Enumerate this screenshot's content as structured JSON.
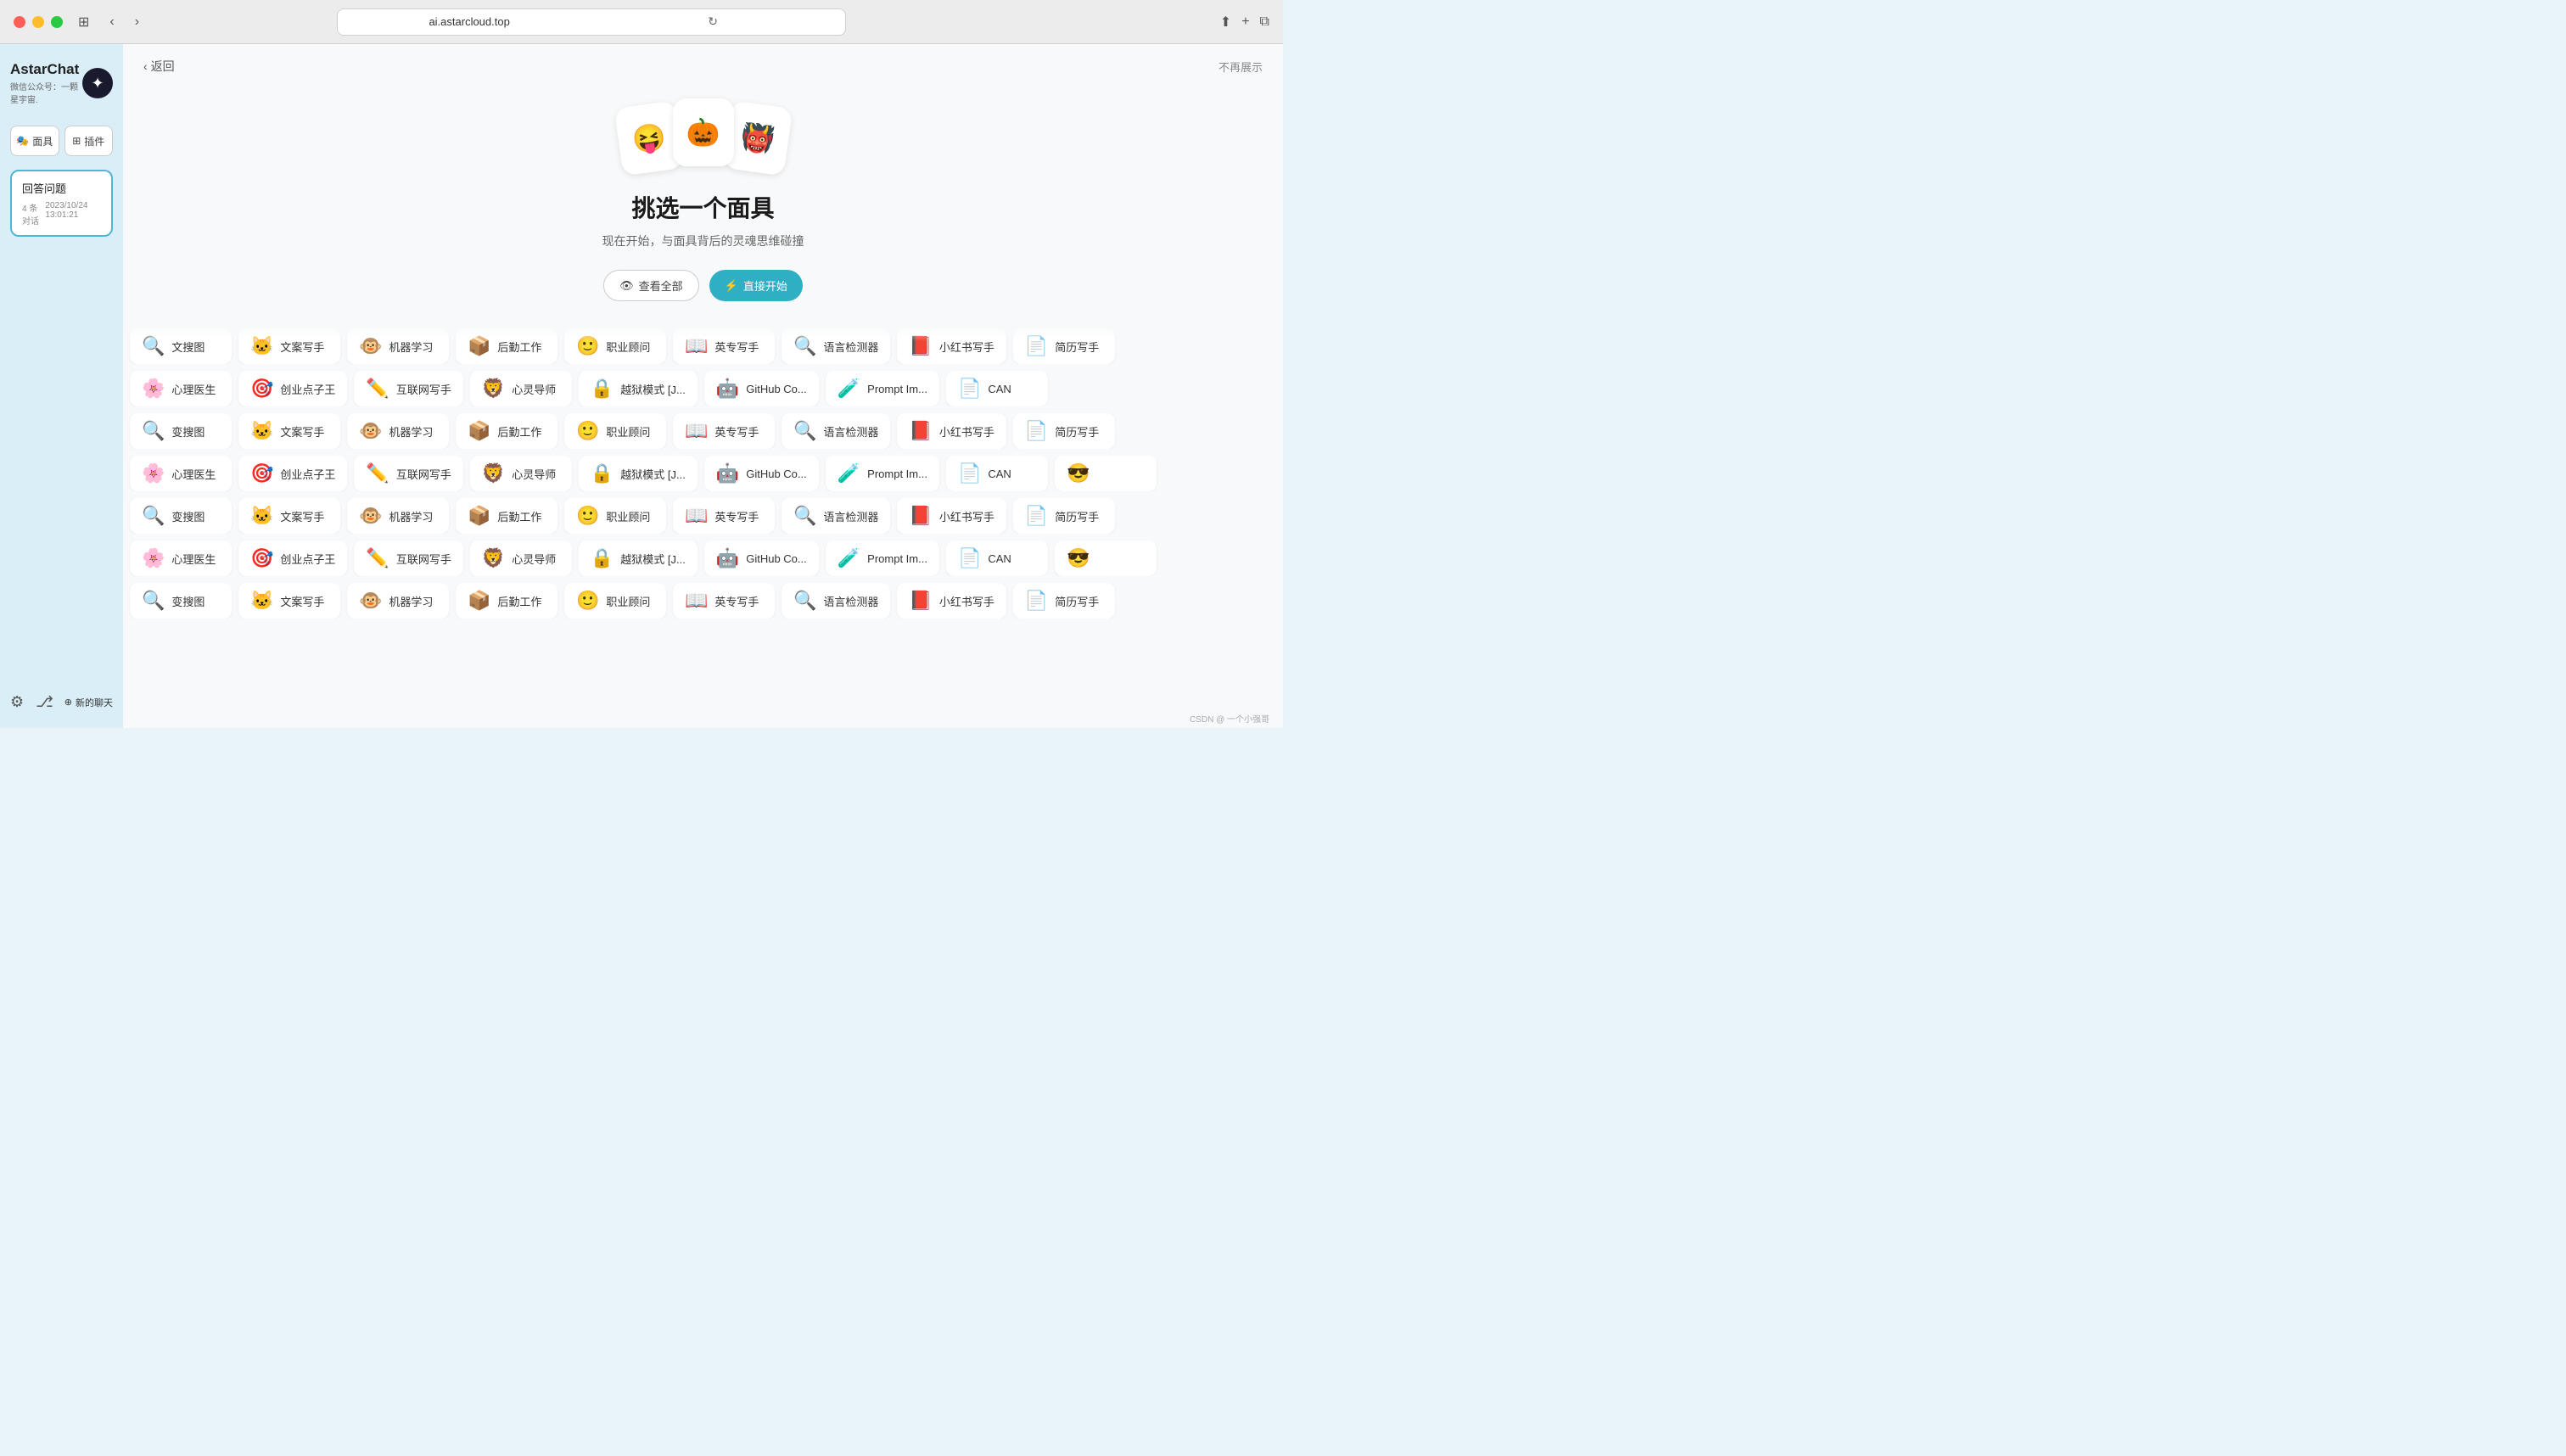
{
  "browser": {
    "url": "ai.astarcloud.top",
    "tab_title": "ai.astarcloud.top"
  },
  "sidebar": {
    "app_title": "AstarChat",
    "app_subtitle": "微信公众号：一颗星宇宙.",
    "tab_mask": "面具",
    "tab_plugin": "插件",
    "chat_item": {
      "title": "回答问题",
      "count": "4 条对话",
      "time": "2023/10/24 13:01:21"
    },
    "new_chat": "新的聊天",
    "no_show": "不再展示"
  },
  "hero": {
    "title": "挑选一个面具",
    "subtitle": "现在开始，与面具背后的灵魂思维碰撞",
    "btn_view_all": "查看全部",
    "btn_start": "直接开始",
    "back_label": "返回"
  },
  "masks": {
    "row1": [
      {
        "icon": "🔍",
        "name": "文搜图"
      },
      {
        "icon": "🐱",
        "name": "文案写手"
      },
      {
        "icon": "🐵",
        "name": "机器学习"
      },
      {
        "icon": "📦",
        "name": "后勤工作"
      },
      {
        "icon": "🙂",
        "name": "职业顾问"
      },
      {
        "icon": "📖",
        "name": "英专写手"
      },
      {
        "icon": "🔍",
        "name": "语言检测器"
      },
      {
        "icon": "📕",
        "name": "小红书写手"
      },
      {
        "icon": "📄",
        "name": "简历写手"
      }
    ],
    "row2": [
      {
        "icon": "🌸",
        "name": "心理医生"
      },
      {
        "icon": "🎯",
        "name": "创业点子王"
      },
      {
        "icon": "✏️",
        "name": "互联网写手"
      },
      {
        "icon": "🦁",
        "name": "心灵导师"
      },
      {
        "icon": "🔒",
        "name": "越狱模式 [J..."
      },
      {
        "icon": "🤖",
        "name": "GitHub Co..."
      },
      {
        "icon": "🧪",
        "name": "Prompt Im..."
      },
      {
        "icon": "📄",
        "name": "CAN"
      }
    ],
    "row3": [
      {
        "icon": "🔍",
        "name": "变搜图"
      },
      {
        "icon": "🐱",
        "name": "文案写手"
      },
      {
        "icon": "🐵",
        "name": "机器学习"
      },
      {
        "icon": "📦",
        "name": "后勤工作"
      },
      {
        "icon": "🙂",
        "name": "职业顾问"
      },
      {
        "icon": "📖",
        "name": "英专写手"
      },
      {
        "icon": "🔍",
        "name": "语言检测器"
      },
      {
        "icon": "📕",
        "name": "小红书写手"
      },
      {
        "icon": "📄",
        "name": "简历写手"
      }
    ],
    "row4": [
      {
        "icon": "🌸",
        "name": "心理医生"
      },
      {
        "icon": "🎯",
        "name": "创业点子王"
      },
      {
        "icon": "✏️",
        "name": "互联网写手"
      },
      {
        "icon": "🦁",
        "name": "心灵导师"
      },
      {
        "icon": "🔒",
        "name": "越狱模式 [J..."
      },
      {
        "icon": "🤖",
        "name": "GitHub Co..."
      },
      {
        "icon": "🧪",
        "name": "Prompt Im..."
      },
      {
        "icon": "📄",
        "name": "CAN"
      },
      {
        "icon": "😎",
        "name": ""
      }
    ],
    "row5": [
      {
        "icon": "🔍",
        "name": "变搜图"
      },
      {
        "icon": "🐱",
        "name": "文案写手"
      },
      {
        "icon": "🐵",
        "name": "机器学习"
      },
      {
        "icon": "📦",
        "name": "后勤工作"
      },
      {
        "icon": "🙂",
        "name": "职业顾问"
      },
      {
        "icon": "📖",
        "name": "英专写手"
      },
      {
        "icon": "🔍",
        "name": "语言检测器"
      },
      {
        "icon": "📕",
        "name": "小红书写手"
      },
      {
        "icon": "📄",
        "name": "简历写手"
      }
    ],
    "row6": [
      {
        "icon": "🌸",
        "name": "心理医生"
      },
      {
        "icon": "🎯",
        "name": "创业点子王"
      },
      {
        "icon": "✏️",
        "name": "互联网写手"
      },
      {
        "icon": "🦁",
        "name": "心灵导师"
      },
      {
        "icon": "🔒",
        "name": "越狱模式 [J..."
      },
      {
        "icon": "🤖",
        "name": "GitHub Co..."
      },
      {
        "icon": "🧪",
        "name": "Prompt Im..."
      },
      {
        "icon": "📄",
        "name": "CAN"
      },
      {
        "icon": "😎",
        "name": ""
      }
    ],
    "row7": [
      {
        "icon": "🔍",
        "name": "变搜图"
      },
      {
        "icon": "🐱",
        "name": "文案写手"
      },
      {
        "icon": "🐵",
        "name": "机器学习"
      },
      {
        "icon": "📦",
        "name": "后勤工作"
      },
      {
        "icon": "🙂",
        "name": "职业顾问"
      },
      {
        "icon": "📖",
        "name": "英专写手"
      },
      {
        "icon": "🔍",
        "name": "语言检测器"
      },
      {
        "icon": "📕",
        "name": "小红书写手"
      },
      {
        "icon": "📄",
        "name": "简历写手"
      }
    ]
  },
  "footer": {
    "credit": "CSDN @ 一个小强哥"
  }
}
